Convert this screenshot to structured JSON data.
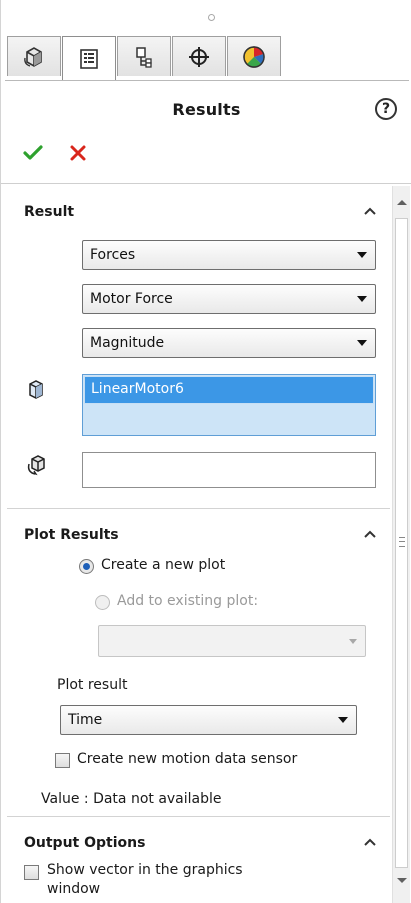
{
  "header": {
    "title": "Results",
    "help_glyph": "?"
  },
  "tabs": [
    {
      "icon": "part-icon"
    },
    {
      "icon": "property-manager-icon",
      "active": true
    },
    {
      "icon": "configuration-manager-icon"
    },
    {
      "icon": "dimxpert-icon"
    },
    {
      "icon": "display-manager-icon"
    }
  ],
  "colors": {
    "accept": "#2ea12e",
    "cancel": "#d9261c",
    "selection": "#3c97e6"
  },
  "result_group": {
    "title": "Result",
    "category": "Forces",
    "subcategory": "Motor Force",
    "component": "Magnitude",
    "selected_entities": [
      "LinearMotor6"
    ],
    "reference_component": ""
  },
  "plot_group": {
    "title": "Plot Results",
    "create_new_plot": "Create a new plot",
    "add_existing_plot": "Add to existing plot:",
    "existing_plot_value": "",
    "plot_result_label": "Plot result",
    "plot_result_value": "Time",
    "sensor_checkbox": "Create new motion data sensor",
    "value_text": "Value : Data not available"
  },
  "output_group": {
    "title": "Output Options",
    "show_vector": "Show vector in the graphics window"
  }
}
